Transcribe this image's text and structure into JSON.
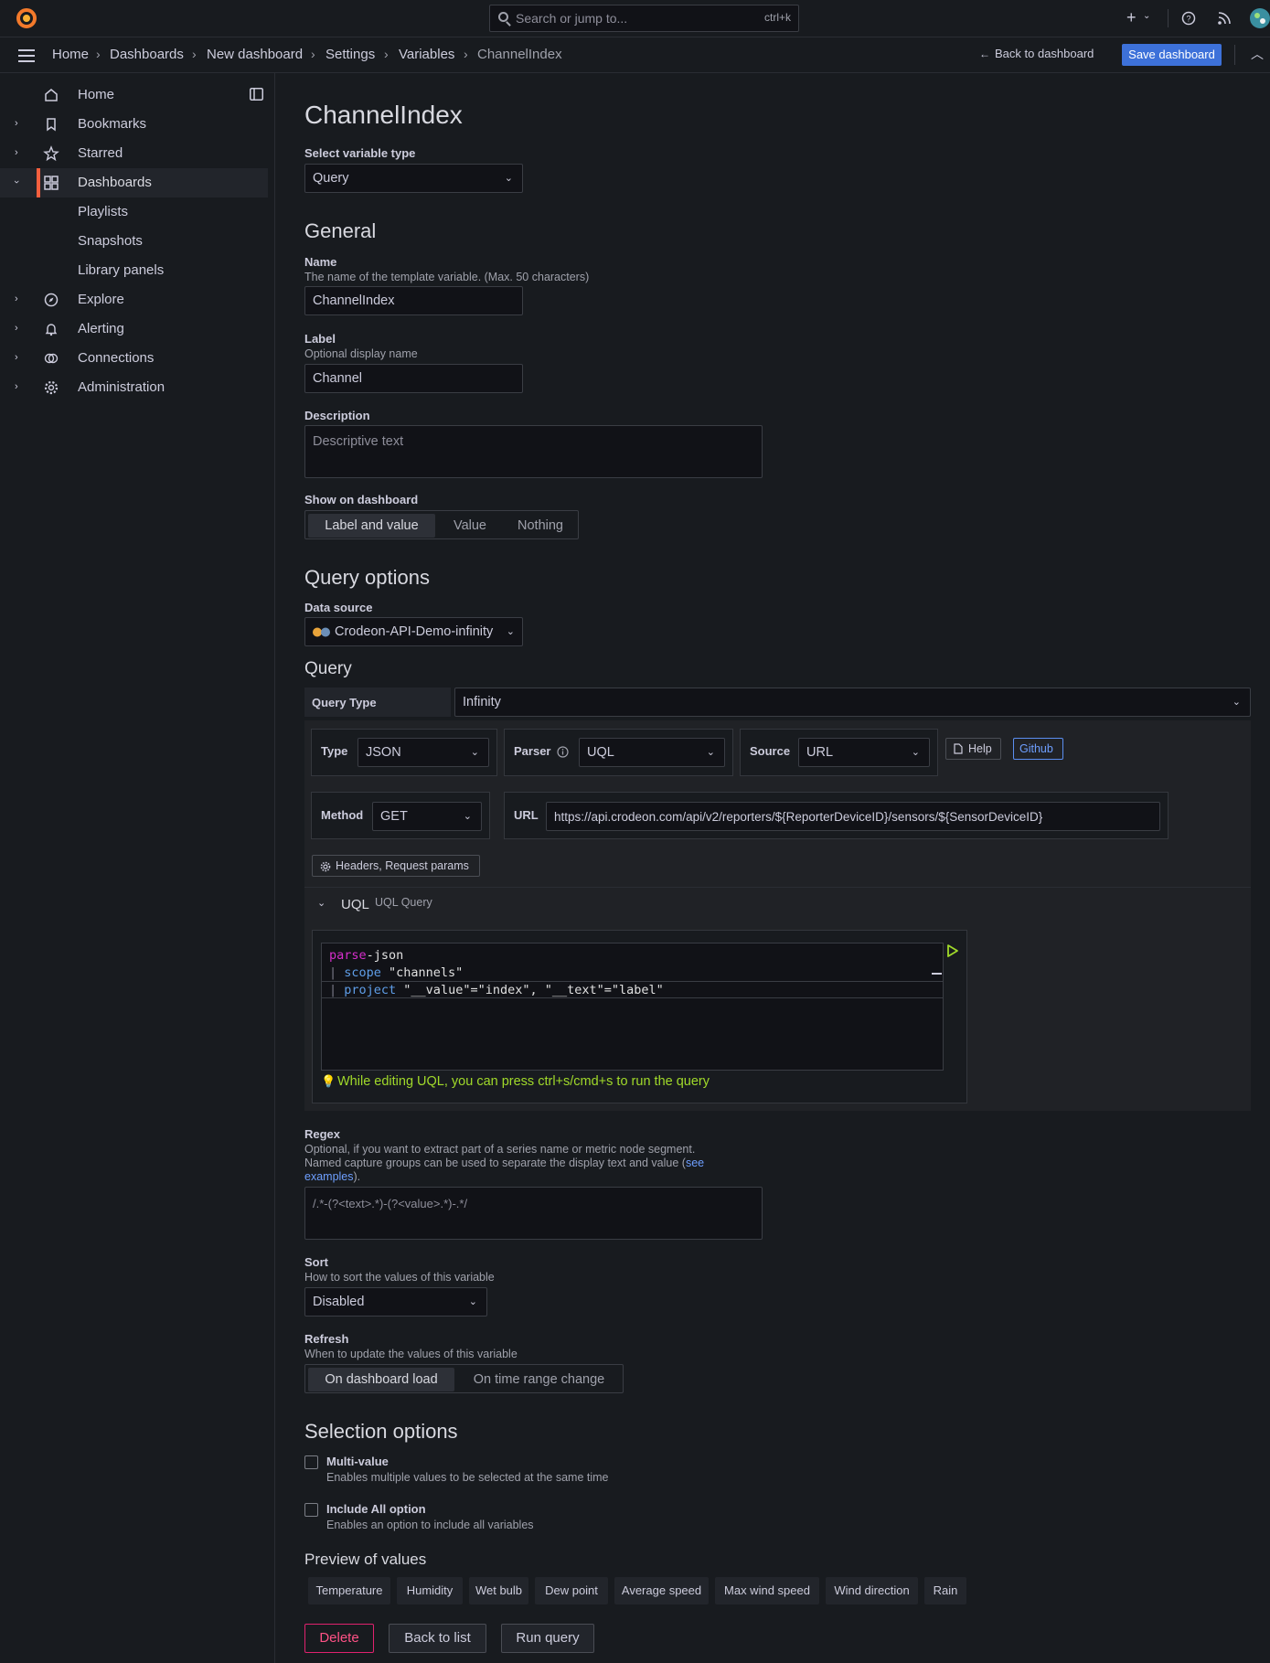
{
  "topbar": {
    "search_placeholder": "Search or jump to...",
    "search_shortcut": "ctrl+k",
    "add_icon": "+"
  },
  "breadcrumb": {
    "items": [
      "Home",
      "Dashboards",
      "New dashboard",
      "Settings",
      "Variables",
      "ChannelIndex"
    ],
    "back_label": "Back to dashboard",
    "save_label": "Save dashboard"
  },
  "sidebar": {
    "items": [
      {
        "label": "Home",
        "icon": "home-icon"
      },
      {
        "label": "Bookmarks",
        "icon": "bookmark-icon"
      },
      {
        "label": "Starred",
        "icon": "star-icon"
      },
      {
        "label": "Dashboards",
        "icon": "dashboards-icon"
      },
      {
        "label": "Playlists"
      },
      {
        "label": "Snapshots"
      },
      {
        "label": "Library panels"
      },
      {
        "label": "Explore",
        "icon": "compass-icon"
      },
      {
        "label": "Alerting",
        "icon": "bell-icon"
      },
      {
        "label": "Connections",
        "icon": "connections-icon"
      },
      {
        "label": "Administration",
        "icon": "gear-icon"
      }
    ]
  },
  "page": {
    "title": "ChannelIndex",
    "var_type_label": "Select variable type",
    "var_type_value": "Query"
  },
  "general": {
    "heading": "General",
    "name_label": "Name",
    "name_desc": "The name of the template variable. (Max. 50 characters)",
    "name_value": "ChannelIndex",
    "label_label": "Label",
    "label_desc": "Optional display name",
    "label_value": "Channel",
    "desc_label": "Description",
    "desc_placeholder": "Descriptive text",
    "show_label": "Show on dashboard",
    "show_options": [
      "Label and value",
      "Value",
      "Nothing"
    ]
  },
  "query_options": {
    "heading": "Query options",
    "ds_label": "Data source",
    "ds_value": "Crodeon-API-Demo-infinity",
    "query_heading": "Query",
    "query_type_label": "Query Type",
    "query_type_value": "Infinity",
    "type_label": "Type",
    "type_value": "JSON",
    "parser_label": "Parser",
    "parser_value": "UQL",
    "source_label": "Source",
    "source_value": "URL",
    "help_label": "Help",
    "github_label": "Github",
    "method_label": "Method",
    "method_value": "GET",
    "url_label": "URL",
    "url_value": "https://api.crodeon.com/api/v2/reporters/${ReporterDeviceID}/sensors/${SensorDeviceID}",
    "headers_label": "Headers, Request params",
    "uql_label": "UQL",
    "uql_sub": "UQL Query",
    "code": {
      "l1a": "parse",
      "l1b": "-json",
      "l2a": "scope",
      "l2b": " \"channels\"",
      "l3a": "project",
      "l3b": " \"__value\"=\"index\", \"__text\"=\"label\""
    },
    "hint": "While editing UQL, you can press ctrl+s/cmd+s to run the query"
  },
  "regex": {
    "label": "Regex",
    "desc1": "Optional, if you want to extract part of a series name or metric node segment.",
    "desc2": "Named capture groups can be used to separate the display text and value (",
    "link1": "see",
    "link2": "examples",
    "desc3": ").",
    "placeholder": "/.*-(?<text>.*)-(?<value>.*)-.*/"
  },
  "sort": {
    "label": "Sort",
    "desc": "How to sort the values of this variable",
    "value": "Disabled"
  },
  "refresh": {
    "label": "Refresh",
    "desc": "When to update the values of this variable",
    "options": [
      "On dashboard load",
      "On time range change"
    ]
  },
  "selection": {
    "heading": "Selection options",
    "multi_label": "Multi-value",
    "multi_desc": "Enables multiple values to be selected at the same time",
    "all_label": "Include All option",
    "all_desc": "Enables an option to include all variables"
  },
  "preview": {
    "heading": "Preview of values",
    "values": [
      "Temperature",
      "Humidity",
      "Wet bulb",
      "Dew point",
      "Average speed",
      "Max wind speed",
      "Wind direction",
      "Rain"
    ]
  },
  "footer": {
    "delete": "Delete",
    "back": "Back to list",
    "run": "Run query"
  },
  "colors": {
    "primary": "#3d71d9",
    "danger": "#e0226e",
    "active_nav": "#f55f3e",
    "hint": "#a0d92a"
  }
}
